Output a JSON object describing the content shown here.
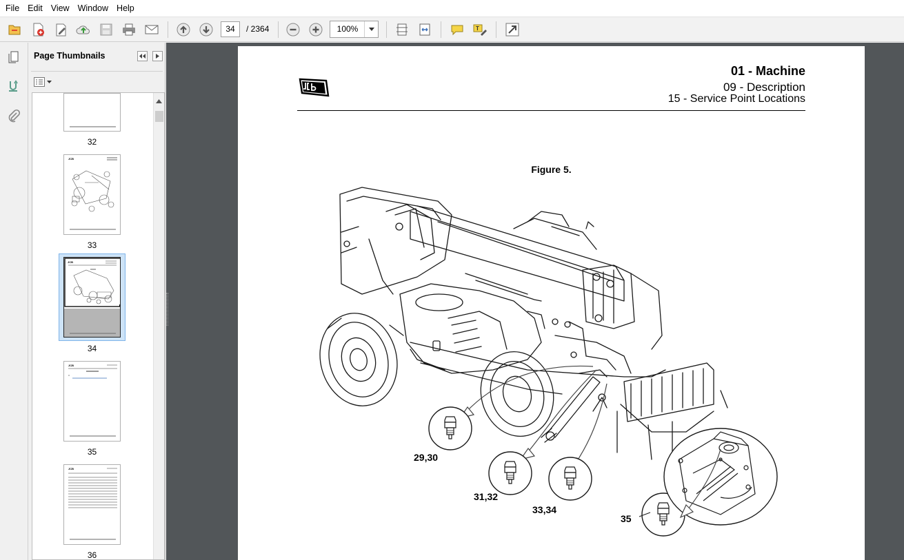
{
  "menu": [
    "File",
    "Edit",
    "View",
    "Window",
    "Help"
  ],
  "toolbar": {
    "current_page": "34",
    "total_pages": "/ 2364",
    "zoom": "100%"
  },
  "panel": {
    "title": "Page Thumbnails"
  },
  "thumbnails": [
    {
      "label": "32"
    },
    {
      "label": "33"
    },
    {
      "label": "34"
    },
    {
      "label": "35"
    },
    {
      "label": "36"
    }
  ],
  "document": {
    "section": "01 - Machine",
    "subsection": "09 - Description",
    "topic": "15 - Service Point Locations",
    "figure_title": "Figure 5.",
    "callouts": [
      "29,30",
      "31,32",
      "33,34",
      "35"
    ]
  },
  "icons": {
    "open": "open-folder-icon",
    "create": "create-pdf-icon",
    "edit": "edit-icon",
    "upload": "cloud-upload-icon",
    "save": "save-disk-icon",
    "print": "printer-icon",
    "email": "envelope-icon",
    "prev": "arrow-up-circle-icon",
    "next": "arrow-down-circle-icon",
    "zoom_out": "zoom-out-icon",
    "zoom_in": "zoom-in-icon",
    "fit_page": "fit-page-icon",
    "fit_width": "fit-width-icon",
    "comment": "speech-bubble-icon",
    "highlight": "highlight-text-icon",
    "fullscreen": "expand-icon"
  }
}
